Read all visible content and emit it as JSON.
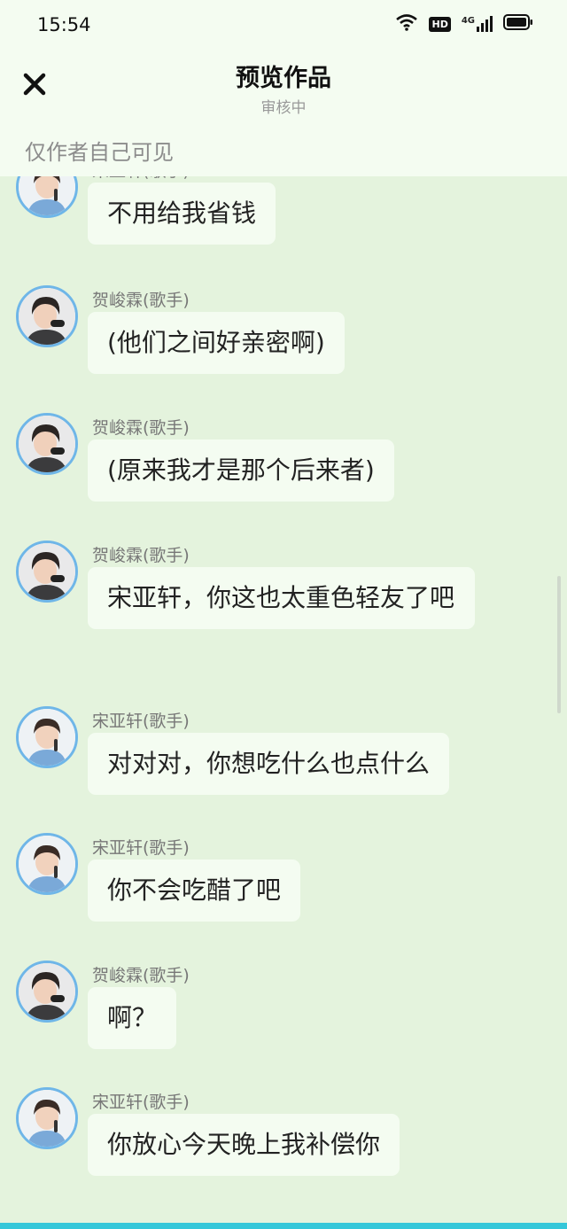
{
  "status": {
    "time": "15:54",
    "hd": "HD",
    "network": "4G"
  },
  "header": {
    "title": "预览作品",
    "subtitle": "审核中",
    "visibility_note": "仅作者自己可见"
  },
  "messages": [
    {
      "sender": "宋亚轩(歌手)",
      "text": "不用给我省钱",
      "avatar": "avatar-songyaxuan"
    },
    {
      "sender": "贺峻霖(歌手)",
      "text": "(他们之间好亲密啊)",
      "avatar": "avatar-hejunlin"
    },
    {
      "sender": "贺峻霖(歌手)",
      "text": "(原来我才是那个后来者)",
      "avatar": "avatar-hejunlin"
    },
    {
      "sender": "贺峻霖(歌手)",
      "text": "宋亚轩，你这也太重色轻友了吧",
      "avatar": "avatar-hejunlin"
    },
    {
      "sender": "宋亚轩(歌手)",
      "text": "对对对，你想吃什么也点什么",
      "avatar": "avatar-songyaxuan"
    },
    {
      "sender": "宋亚轩(歌手)",
      "text": "你不会吃醋了吧",
      "avatar": "avatar-songyaxuan"
    },
    {
      "sender": "贺峻霖(歌手)",
      "text": "啊？",
      "avatar": "avatar-hejunlin"
    },
    {
      "sender": "宋亚轩(歌手)",
      "text": "你放心今天晚上我补偿你",
      "avatar": "avatar-songyaxuan"
    }
  ],
  "colors": {
    "background": "#e4f3dd",
    "bubble": "#f4fcf1",
    "avatar_ring": "#6fb6e8",
    "bottom_accent": "#35c7d9"
  }
}
